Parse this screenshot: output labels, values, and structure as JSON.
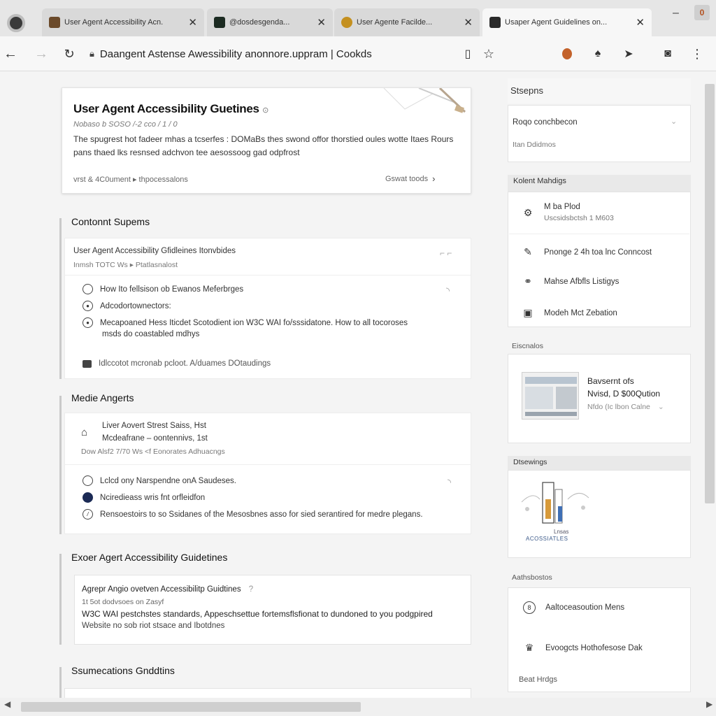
{
  "tabs": [
    {
      "label": "User Agent Accessibility Acn.",
      "favicon_color": "#6b4a2a",
      "active": false
    },
    {
      "label": "@dosdesgenda...",
      "favicon_color": "#1c2b22",
      "active": false
    },
    {
      "label": "User Agente Facilde...",
      "favicon_color": "#c49020",
      "active": false
    },
    {
      "label": "Usaper Agent Guidelines on...",
      "favicon_color": "#2a2a2a",
      "active": true
    }
  ],
  "window": {
    "minimize": "–",
    "ext_label": "0"
  },
  "nav": {
    "url": "Daangent Astense Awessibility anonnore.uppram | Cookds",
    "icons": [
      "back-icon",
      "forward-icon",
      "reload-icon",
      "lock-icon",
      "bookmark-icon",
      "star-icon",
      "extension-icon",
      "tree-icon",
      "send-icon",
      "camera-icon",
      "menu-icon"
    ]
  },
  "hero": {
    "title": "User Agent Accessibility Guetines",
    "subtitle": "Nobaso b SOSO /-2 cco / 1 / 0",
    "description": "The spugrest hot fadeer mhas a tcserfes : DOMaBs thes swond offor thorstied oules wotte Itaes Rours pans thaed lks resnsed adchvon tee aesossoog gad odpfrost",
    "meta": "vrst & 4C0ument  ▸  thpocessalons",
    "action": "Gswat toods"
  },
  "sections": [
    {
      "title": "Contonnt Supems",
      "header": "User Agent Accessibility Gfidleines Itonvbides",
      "header_sub": "Inmsh TOTC Ws ▸ Ptatlasnalost",
      "rows": [
        "How Ito fellsison ob Ewanos Meferbrges",
        "Adcodortownectors:",
        "Mecapoaned Hess Iticdet Scotodient ion W3C WAI fo/sssidatone. How to all tocoroses",
        "msds do coastabled mdhys"
      ],
      "footer": "Idlccotot mcronab pcloot. A/duames DOtaudings"
    },
    {
      "title": "Medie Angerts",
      "header": "Liver Aovert Strest Saiss, Hst",
      "header_sub": "Mcdeafrane – oontennivs, 1st",
      "header_sub2": "Dow Alsf2 7/70 Ws <f Eonorates Adhuacngs",
      "rows": [
        "Lclcd ony Narspendne onA Saudeses.",
        "Nciredieass wris fnt orfleidfon",
        "Rensoestoirs to so Ssidanes of the Mesosbnes asso for sied serantired for medre plegans."
      ]
    },
    {
      "title": "Exoer Agert Accessibility Guidetines",
      "header": "Agrepr Angio ovetven Accessibilitp Guidtines",
      "header_sub": "1t 5ot dodvsoes on Zasyf",
      "body": "W3C WAI pestchstes standards, Appeschsettue fortemsflsfionat to dundoned to you podgpired",
      "body2": "Website no sob riot stsace and Ibotdnes"
    },
    {
      "title": "Ssumecations Gnddtins"
    }
  ],
  "sidebar": {
    "steps_title": "Stsepns",
    "steps_row1": "Roqo conchbecon",
    "steps_row2": "Itan Ddidmos",
    "content_head": "Kolent Mahdigs",
    "items": [
      {
        "icon": "settings-icon",
        "label": "M ba Plod",
        "sub": "Uscsidsbctsh 1 M603"
      },
      {
        "icon": "pencil-icon",
        "label": "Pnonge 2 4h toa lnc Conncost",
        "sub": ""
      },
      {
        "icon": "users-icon",
        "label": "Mahse Afbfls Listigys",
        "sub": ""
      },
      {
        "icon": "calendar-icon",
        "label": "Modeh Mct Zebation",
        "sub": ""
      }
    ],
    "screens_head": "Eiscnalos",
    "screen_line1": "Bavsernt ofs",
    "screen_line2": "Nvisd,  D  $00Qution",
    "screen_line3": "Nfdo (Ic lbon Calne",
    "drawings_head": "Dtsewings",
    "drawing_caption1": "Lnsas",
    "drawing_caption2": "ACOSSIATLES",
    "links_head": "Aathsbostos",
    "links": [
      {
        "icon": "info-circle-icon",
        "label": "Aaltoceasoution Mens"
      },
      {
        "icon": "badge-icon",
        "label": "Evoogcts Hothofesose Dak"
      }
    ],
    "more_link": "Beat Hrdgs"
  }
}
